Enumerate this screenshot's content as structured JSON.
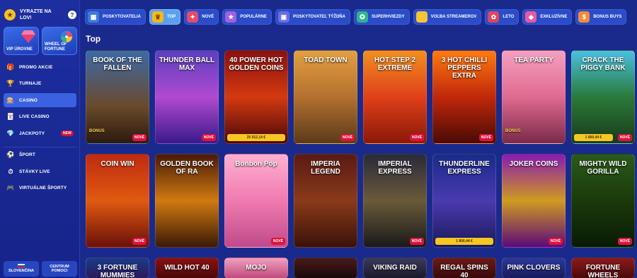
{
  "sidebar": {
    "promo": "VYRAZTE NA LOV!",
    "help": "?",
    "tiles": [
      {
        "label": "VIP ÚROVNE"
      },
      {
        "label": "WHEEL OF FORTUNE"
      }
    ],
    "items": [
      {
        "label": "PROMO AKCIE",
        "icon": "gift-icon",
        "glyph": "🎁"
      },
      {
        "label": "TURNAJE",
        "icon": "trophy-icon",
        "glyph": "🏆"
      },
      {
        "label": "CASINO",
        "icon": "slot-machine-icon",
        "glyph": "🎰",
        "active": true
      },
      {
        "label": "LIVE CASINO",
        "icon": "cards-icon",
        "glyph": "🃏"
      },
      {
        "label": "JACKPOTY",
        "icon": "diamond-icon",
        "glyph": "💎",
        "badge": "NEW"
      },
      {
        "label": "ŠPORT",
        "icon": "soccer-ball-icon",
        "glyph": "⚽"
      },
      {
        "label": "STÁVKY LIVE",
        "icon": "live-stopwatch-icon",
        "glyph": "⏱"
      },
      {
        "label": "VIRTUÁLNE ŠPORTY",
        "icon": "virtual-sports-icon",
        "glyph": "🎮"
      }
    ],
    "bottom": [
      {
        "label": "SLOVENČINA"
      },
      {
        "label": "CENTRUM POMOCI"
      }
    ]
  },
  "categories": [
    {
      "label": "POSKYTOVATELIA",
      "icon": "providers-icon",
      "color": "#3d7bd9",
      "glyph": "▦"
    },
    {
      "label": "TOP",
      "icon": "crown-icon",
      "color": "#f5b81d",
      "glyph": "♛",
      "active": true
    },
    {
      "label": "NOVÉ",
      "icon": "new-icon",
      "color": "#e44b6a",
      "glyph": "✦"
    },
    {
      "label": "POPULÁRNE",
      "icon": "popular-icon",
      "color": "#a05fe0",
      "glyph": "★"
    },
    {
      "label": "POSKYTOVATEĽ TÝŽDŇA",
      "icon": "provider-week-icon",
      "color": "#6c6ce8",
      "glyph": "▣"
    },
    {
      "label": "SUPERHVIEZDY",
      "icon": "superstar-icon",
      "color": "#2fb58a",
      "glyph": "✪"
    },
    {
      "label": "VOĽBA STREAMEROV",
      "icon": "lightning-icon",
      "color": "#f2c43a",
      "glyph": "⚡"
    },
    {
      "label": "LETO",
      "icon": "summer-icon",
      "color": "#e2435c",
      "glyph": "✿"
    },
    {
      "label": "EXKLUZÍVNE",
      "icon": "exclusive-icon",
      "color": "#e85aa0",
      "glyph": "◆"
    },
    {
      "label": "BONUS BUYS",
      "icon": "bonus-buy-icon",
      "color": "#f28b3a",
      "glyph": "$"
    }
  ],
  "section_title": "Top",
  "games_row1": [
    {
      "title": "BOOK OF THE FALLEN",
      "bg": "linear-gradient(180deg,#3b6aa8,#6a4a2a 60%,#2a1a0e)",
      "bonus": "BONUS",
      "new": "NOVÉ"
    },
    {
      "title": "THUNDER BALL MAX",
      "bg": "linear-gradient(180deg,#5a3fc0,#b04ad0 50%,#3a1a8a)",
      "new": "NOVÉ"
    },
    {
      "title": "40 POWER HOT GOLDEN COINS",
      "bg": "linear-gradient(180deg,#8a1010,#d43a10 50%,#4a0808)",
      "jackpot": "25 912,14 €"
    },
    {
      "title": "TOAD TOWN",
      "bg": "linear-gradient(180deg,#e2a040,#b47030 50%,#5a3a1a)",
      "new": "NOVÉ"
    },
    {
      "title": "HOT STEP 2 EXTREME",
      "bg": "linear-gradient(180deg,#f09020,#e0401a 50%,#8a1808)",
      "new": "NOVÉ"
    },
    {
      "title": "3 HOT CHILLI PEPPERS EXTRA",
      "bg": "linear-gradient(180deg,#ff7a10,#c0280a 50%,#4a0a04)",
      "new": "NOVÉ"
    },
    {
      "title": "TEA PARTY",
      "bg": "linear-gradient(180deg,#f5a0c0,#e06a90 50%,#7a2a4a)",
      "bonus": "BONUS"
    },
    {
      "title": "CRACK THE PIGGY BANK",
      "bg": "linear-gradient(180deg,#4ac0e0,#2a7a3a 50%,#1a3a1a)",
      "jackpot": "1 800,44 €",
      "new": "NOVÉ"
    }
  ],
  "games_row2": [
    {
      "title": "COIN WIN",
      "bg": "linear-gradient(180deg,#c02a10,#e05a10 50%,#6a1008)",
      "new": "NOVÉ"
    },
    {
      "title": "GOLDEN BOOK OF RA",
      "bg": "linear-gradient(180deg,#4a1a08,#d07a10 50%,#3a1a06)"
    },
    {
      "title": "Bonbon Pop",
      "bg": "linear-gradient(180deg,#ffb0d0,#f07ab0 50%,#c04a8a)",
      "new": "NOVÉ"
    },
    {
      "title": "IMPERIA LEGEND",
      "bg": "linear-gradient(180deg,#5a1a14,#8a3a1a 50%,#3a1208)"
    },
    {
      "title": "IMPERIAL EXPRESS",
      "bg": "linear-gradient(180deg,#2a2a3a,#6a5a3a 50%,#1a1a1a)",
      "new": "NOVÉ"
    },
    {
      "title": "THUNDERLINE EXPRESS",
      "bg": "linear-gradient(180deg,#1a2a8a,#4a3ab0 50%,#1a1a5a)",
      "jackpot": "1 800,44 €"
    },
    {
      "title": "JOKER COINS",
      "bg": "linear-gradient(180deg,#8a1ab0,#d09a20 50%,#5a0a7a)",
      "new": "NOVÉ"
    },
    {
      "title": "MIGHTY WILD GORILLA",
      "bg": "linear-gradient(180deg,#2a5a1a,#1a3a0a 50%,#0a1a06)",
      "new": "NOVÉ"
    }
  ],
  "games_row3": [
    {
      "title": "3 FORTUNE MUMMIES",
      "bg": "linear-gradient(180deg,#1a3a8a,#2a1a5a)"
    },
    {
      "title": "WILD HOT 40",
      "bg": "linear-gradient(180deg,#8a1010,#4a0808)"
    },
    {
      "title": "MOJO",
      "bg": "linear-gradient(180deg,#f0a0c0,#c04a7a)"
    },
    {
      "title": "",
      "bg": "linear-gradient(180deg,#4a1a1a,#1a0a0a)"
    },
    {
      "title": "VIKING RAID",
      "bg": "linear-gradient(180deg,#3a3a5a,#1a1a2a)"
    },
    {
      "title": "REGAL SPINS 40",
      "bg": "linear-gradient(180deg,#6a1a1a,#3a0a0a)"
    },
    {
      "title": "PINK CLOVERS",
      "bg": "linear-gradient(180deg,#2a3a9a,#1a1a5a)"
    },
    {
      "title": "FORTUNE WHEELS",
      "bg": "linear-gradient(180deg,#8a1a1a,#4a0a0a)"
    }
  ]
}
